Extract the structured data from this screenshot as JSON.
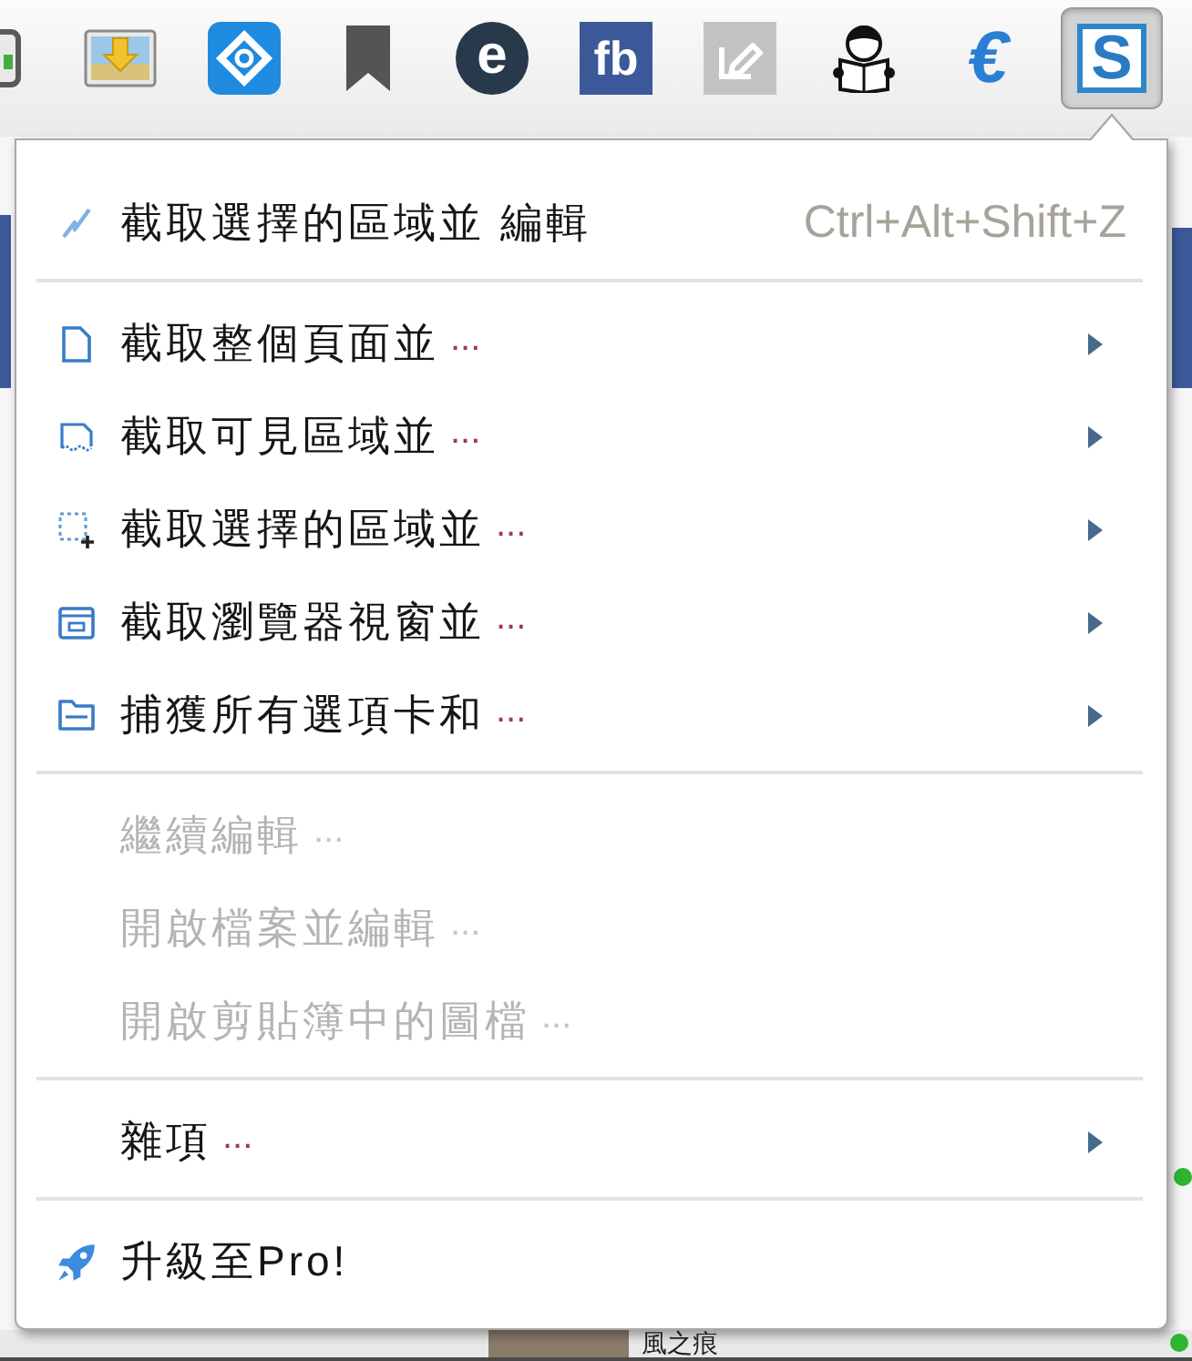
{
  "toolbar": {
    "buttons": [
      {
        "selected": false
      },
      {
        "selected": false
      },
      {
        "selected": false
      },
      {
        "selected": false,
        "glyph": "e"
      },
      {
        "selected": false,
        "glyph": "fb"
      },
      {
        "selected": false
      },
      {
        "selected": false
      },
      {
        "selected": false,
        "glyph": "€"
      },
      {
        "selected": true,
        "glyph": "S"
      }
    ]
  },
  "menu": {
    "sections": [
      {
        "items": [
          {
            "label": "截取選擇的區域並 編輯",
            "shortcut": "Ctrl+Alt+Shift+Z",
            "disabled": false,
            "submenu": false
          }
        ]
      },
      {
        "items": [
          {
            "label": "截取整個頁面並",
            "suffix": "...",
            "disabled": false,
            "submenu": true
          },
          {
            "label": "截取可見區域並",
            "suffix": "...",
            "disabled": false,
            "submenu": true
          },
          {
            "label": "截取選擇的區域並",
            "suffix": "...",
            "disabled": false,
            "submenu": true
          },
          {
            "label": "截取瀏覽器視窗並",
            "suffix": "...",
            "disabled": false,
            "submenu": true
          },
          {
            "label": "捕獲所有選項卡和",
            "suffix": "...",
            "disabled": false,
            "submenu": true
          }
        ]
      },
      {
        "items": [
          {
            "label": "繼續編輯",
            "suffix": "...",
            "disabled": true,
            "submenu": false
          },
          {
            "label": "開啟檔案並編輯",
            "suffix": "...",
            "disabled": true,
            "submenu": false
          },
          {
            "label": "開啟剪貼簿中的圖檔",
            "suffix": "...",
            "disabled": true,
            "submenu": false
          }
        ]
      },
      {
        "items": [
          {
            "label": "雜項",
            "suffix": "...",
            "disabled": false,
            "submenu": true
          }
        ]
      },
      {
        "items": [
          {
            "label": "升級至Pro!",
            "disabled": false,
            "submenu": false
          }
        ]
      }
    ]
  },
  "background_page": {
    "user_name": "風之痕"
  }
}
